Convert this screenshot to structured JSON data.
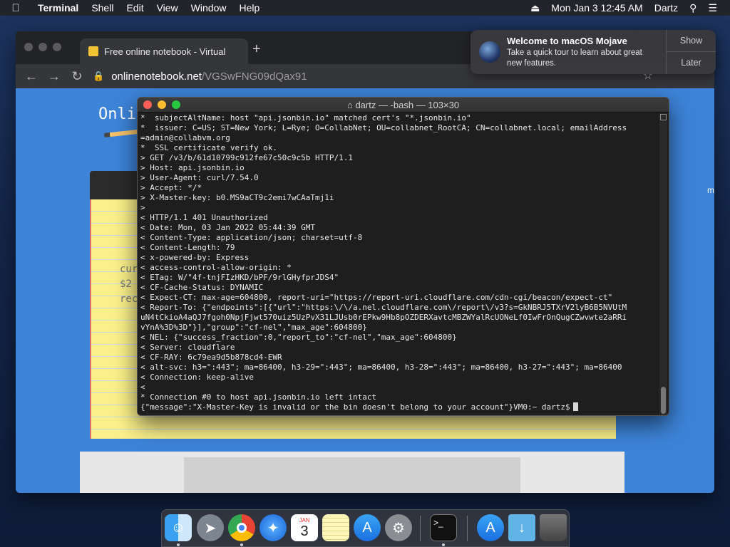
{
  "menubar": {
    "apple_icon": "apple-logo",
    "items": [
      "Terminal",
      "Shell",
      "Edit",
      "View",
      "Window",
      "Help"
    ],
    "datetime": "Mon Jan 3  12:45 AM",
    "user": "Dartz"
  },
  "browser": {
    "tab_title": "Free online notebook - Virtual",
    "new_tab": "+",
    "url_host": "onlinenotebook.net",
    "url_path": "/VGSwFNG09dQax91",
    "page_title": "Onli",
    "notepad_lines": [
      "cur",
      "$2",
      "rec"
    ],
    "edge_char": "m"
  },
  "notification": {
    "title": "Welcome to macOS Mojave",
    "body": "Take a quick tour to learn about great new features.",
    "show_label": "Show",
    "later_label": "Later"
  },
  "terminal": {
    "title": "dartz — -bash — 103×30",
    "lines": [
      "*  subjectAltName: host \"api.jsonbin.io\" matched cert's \"*.jsonbin.io\"",
      "*  issuer: C=US; ST=New York; L=Rye; O=CollabNet; OU=collabnet_RootCA; CN=collabnet.local; emailAddress",
      "=admin@collabvm.org",
      "*  SSL certificate verify ok.",
      "> GET /v3/b/61d10799c912fe67c50c9c5b HTTP/1.1",
      "> Host: api.jsonbin.io",
      "> User-Agent: curl/7.54.0",
      "> Accept: */*",
      "> X-Master-key: b0.MS9aCT9c2emi7wCAaTmj1i",
      ">",
      "< HTTP/1.1 401 Unauthorized",
      "< Date: Mon, 03 Jan 2022 05:44:39 GMT",
      "< Content-Type: application/json; charset=utf-8",
      "< Content-Length: 79",
      "< x-powered-by: Express",
      "< access-control-allow-origin: *",
      "< ETag: W/\"4f-tnjFIzHKD/bPF/9rlGHyfprJDS4\"",
      "< CF-Cache-Status: DYNAMIC",
      "< Expect-CT: max-age=604800, report-uri=\"https://report-uri.cloudflare.com/cdn-cgi/beacon/expect-ct\"",
      "< Report-To: {\"endpoints\":[{\"url\":\"https:\\/\\/a.nel.cloudflare.com\\/report\\/v3?s=GkNBRJ5TXrV2lyB6B5NVUtM",
      "uN4tCkioA4aQJ7fgoh0NpjFjwt570uiz5UzPvX31LJUsb0rEPkw9Hb8pOZDERXavtcMBZWYalRcUONeLf0IwFrOnQugCZwvwte2aRRi",
      "vYnA%3D%3D\"}],\"group\":\"cf-nel\",\"max_age\":604800}",
      "< NEL: {\"success_fraction\":0,\"report_to\":\"cf-nel\",\"max_age\":604800}",
      "< Server: cloudflare",
      "< CF-RAY: 6c79ea9d5b878cd4-EWR",
      "< alt-svc: h3=\":443\"; ma=86400, h3-29=\":443\"; ma=86400, h3-28=\":443\"; ma=86400, h3-27=\":443\"; ma=86400",
      "< Connection: keep-alive",
      "<",
      "* Connection #0 to host api.jsonbin.io left intact"
    ],
    "last_line": "{\"message\":\"X-Master-Key is invalid or the bin doesn't belong to your account\"}VM0:~ dartz$"
  },
  "dock": {
    "apps": [
      "finder",
      "launchpad",
      "chrome",
      "safari",
      "calendar",
      "notes",
      "app-store",
      "system-preferences",
      "terminal",
      "app-store-downloads",
      "downloads-folder",
      "trash"
    ],
    "calendar_month": "JAN",
    "calendar_day": "3"
  }
}
